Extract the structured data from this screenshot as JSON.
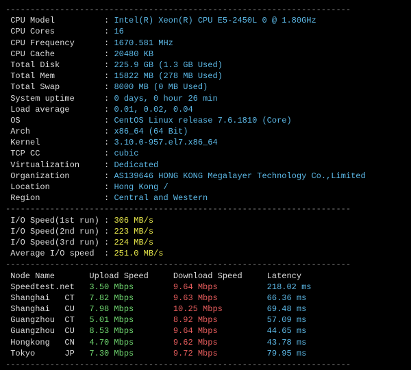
{
  "sep": "----------------------------------------------------------------------",
  "sys": [
    {
      "label": "CPU Model",
      "value": "Intel(R) Xeon(R) CPU E5-2450L 0 @ 1.80GHz"
    },
    {
      "label": "CPU Cores",
      "value": "16"
    },
    {
      "label": "CPU Frequency",
      "value": "1670.581 MHz"
    },
    {
      "label": "CPU Cache",
      "value": "20480 KB"
    },
    {
      "label": "Total Disk",
      "value": "225.9 GB (1.3 GB Used)"
    },
    {
      "label": "Total Mem",
      "value": "15822 MB (278 MB Used)"
    },
    {
      "label": "Total Swap",
      "value": "8000 MB (0 MB Used)"
    },
    {
      "label": "System uptime",
      "value": "0 days, 0 hour 26 min"
    },
    {
      "label": "Load average",
      "value": "0.01, 0.02, 0.04"
    },
    {
      "label": "OS",
      "value": "CentOS Linux release 7.6.1810 (Core)"
    },
    {
      "label": "Arch",
      "value": "x86_64 (64 Bit)"
    },
    {
      "label": "Kernel",
      "value": "3.10.0-957.el7.x86_64"
    },
    {
      "label": "TCP CC",
      "value": "cubic"
    },
    {
      "label": "Virtualization",
      "value": "Dedicated"
    },
    {
      "label": "Organization",
      "value": "AS139646 HONG KONG Megalayer Technology Co.,Limited"
    },
    {
      "label": "Location",
      "value": "Hong Kong / "
    },
    {
      "label": "Region",
      "value": "Central and Western"
    }
  ],
  "io": [
    {
      "label": "I/O Speed(1st run)",
      "value": "306 MB/s",
      "cls": "yellow"
    },
    {
      "label": "I/O Speed(2nd run)",
      "value": "223 MB/s",
      "cls": "yellow"
    },
    {
      "label": "I/O Speed(3rd run)",
      "value": "224 MB/s",
      "cls": "yellow"
    },
    {
      "label": "Average I/O speed",
      "value": "251.0 MB/s",
      "cls": "yellow"
    }
  ],
  "net_header": {
    "node": "Node Name",
    "up": "Upload Speed",
    "down": "Download Speed",
    "lat": "Latency"
  },
  "net": [
    {
      "name": "Speedtest.net",
      "up": "3.50 Mbps",
      "down": "9.64 Mbps",
      "lat": "218.02 ms"
    },
    {
      "name": "Shanghai   CT",
      "up": "7.82 Mbps",
      "down": "9.63 Mbps",
      "lat": "66.36 ms"
    },
    {
      "name": "Shanghai   CU",
      "up": "7.98 Mbps",
      "down": "10.25 Mbps",
      "lat": "69.48 ms"
    },
    {
      "name": "Guangzhou  CT",
      "up": "5.01 Mbps",
      "down": "8.92 Mbps",
      "lat": "57.09 ms"
    },
    {
      "name": "Guangzhou  CU",
      "up": "8.53 Mbps",
      "down": "9.64 Mbps",
      "lat": "44.65 ms"
    },
    {
      "name": "Hongkong   CN",
      "up": "4.70 Mbps",
      "down": "9.62 Mbps",
      "lat": "43.78 ms"
    },
    {
      "name": "Tokyo      JP",
      "up": "7.30 Mbps",
      "down": "9.72 Mbps",
      "lat": "79.95 ms"
    }
  ],
  "chart_data": {
    "type": "table",
    "title": "Network Speed Test",
    "columns": [
      "Node Name",
      "Upload Speed (Mbps)",
      "Download Speed (Mbps)",
      "Latency (ms)"
    ],
    "rows": [
      [
        "Speedtest.net",
        3.5,
        9.64,
        218.02
      ],
      [
        "Shanghai CT",
        7.82,
        9.63,
        66.36
      ],
      [
        "Shanghai CU",
        7.98,
        10.25,
        69.48
      ],
      [
        "Guangzhou CT",
        5.01,
        8.92,
        57.09
      ],
      [
        "Guangzhou CU",
        8.53,
        9.64,
        44.65
      ],
      [
        "Hongkong CN",
        4.7,
        9.62,
        43.78
      ],
      [
        "Tokyo JP",
        7.3,
        9.72,
        79.95
      ]
    ]
  }
}
